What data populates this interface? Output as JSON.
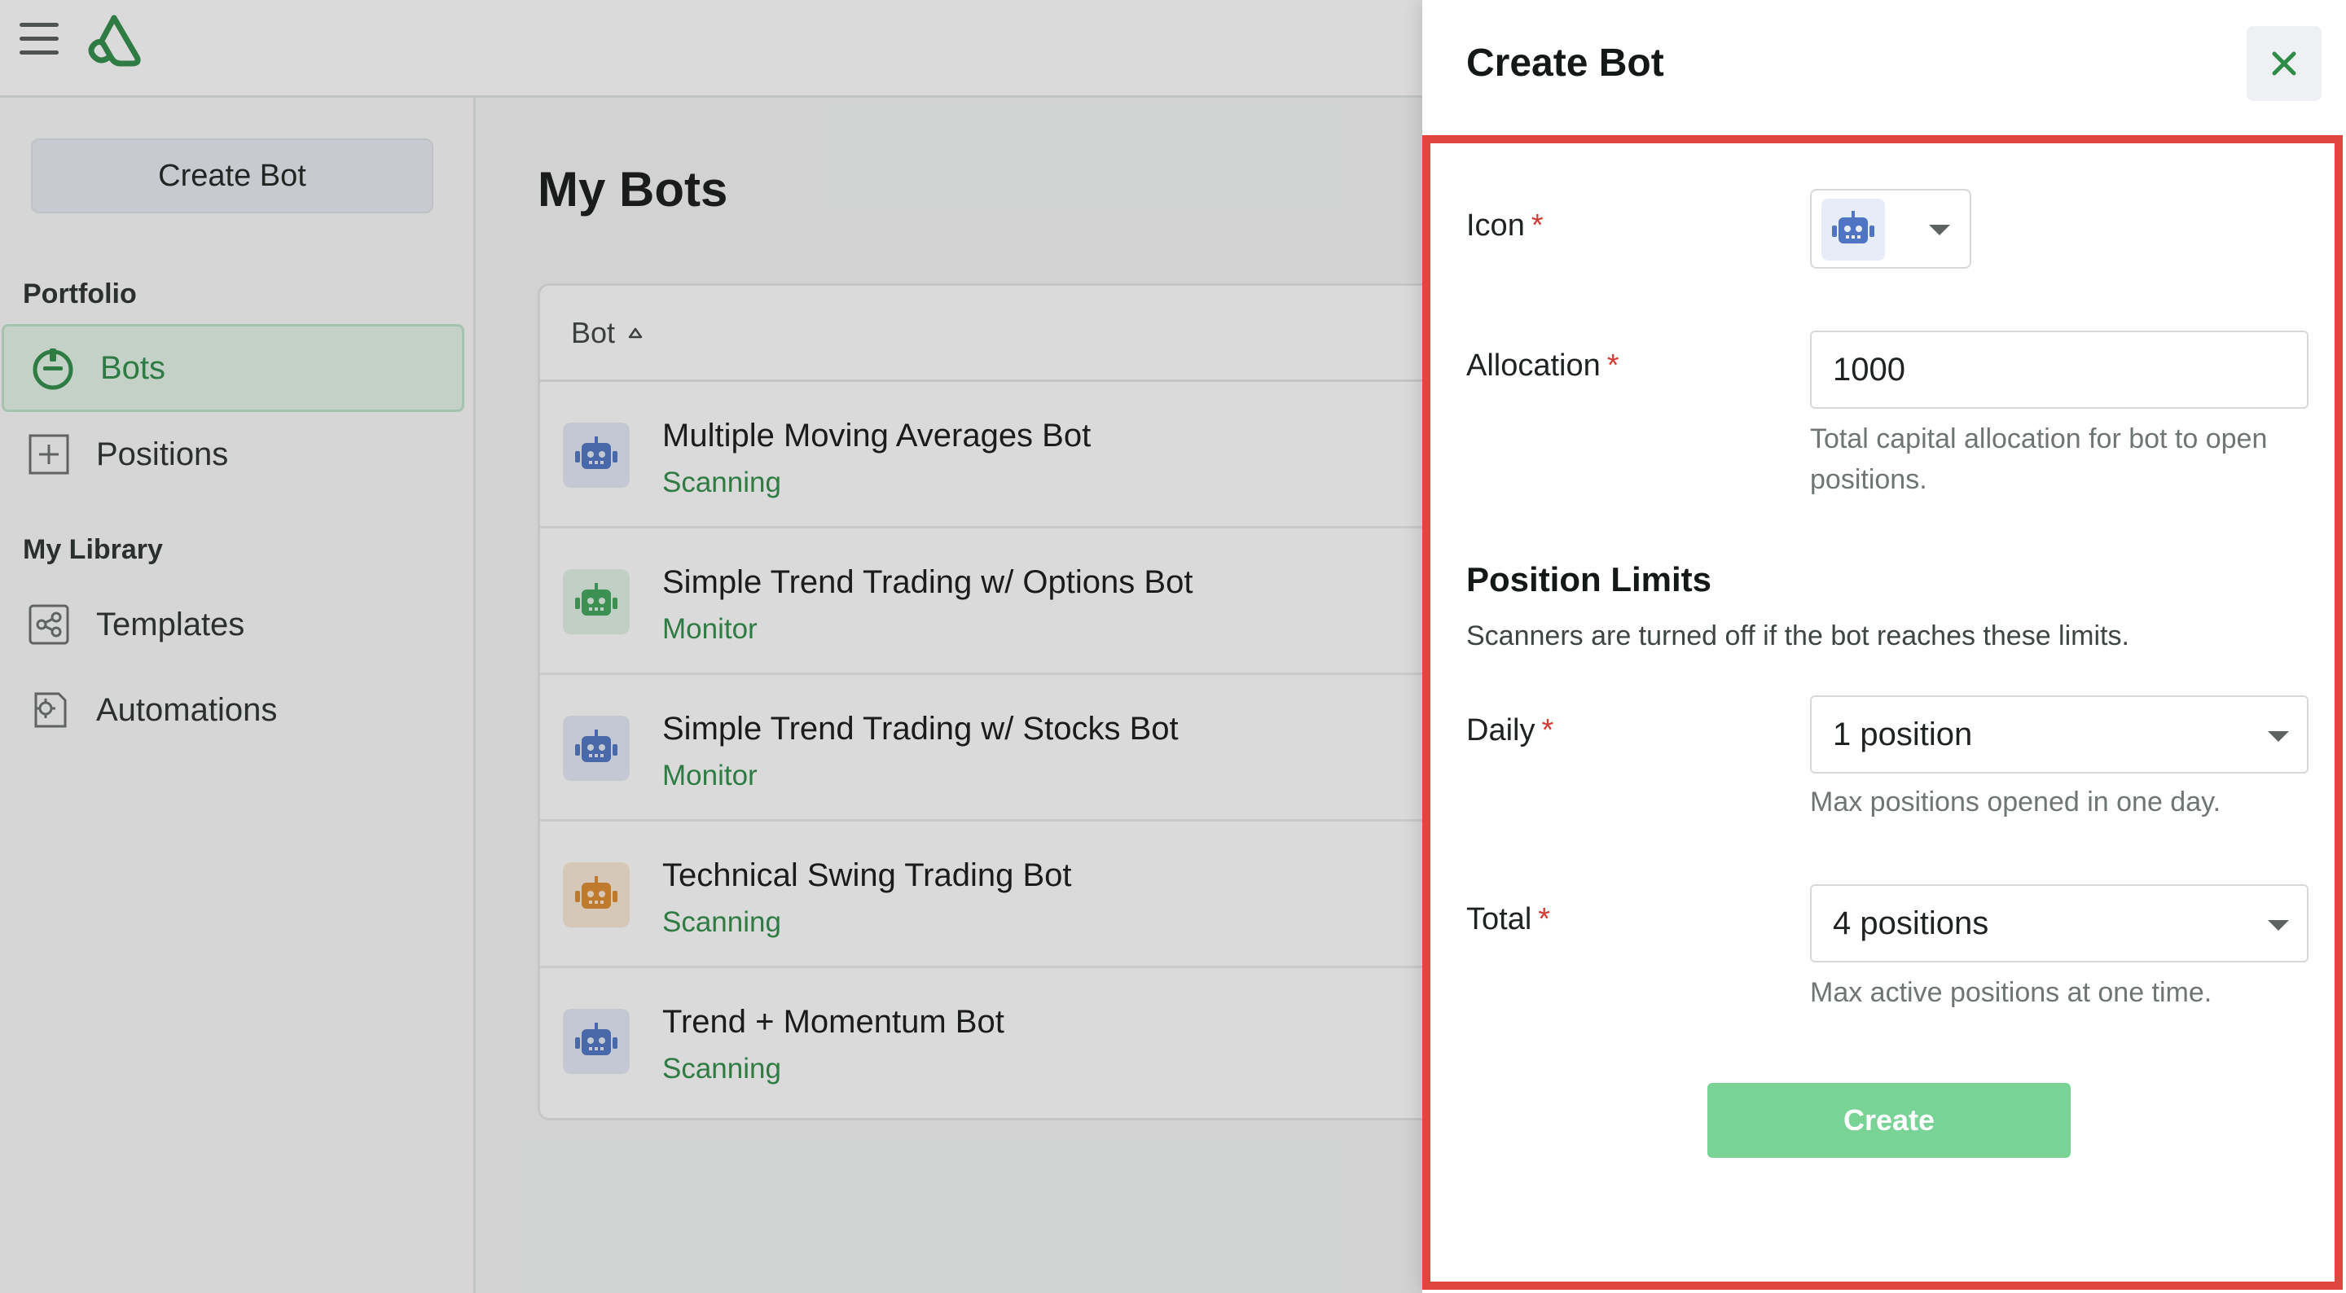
{
  "sidebar": {
    "create_button": "Create Bot",
    "portfolio_heading": "Portfolio",
    "library_heading": "My Library",
    "items": [
      {
        "label": "Bots"
      },
      {
        "label": "Positions"
      },
      {
        "label": "Templates"
      },
      {
        "label": "Automations"
      }
    ]
  },
  "main": {
    "title": "My Bots",
    "table": {
      "column_header": "Bot",
      "rows": [
        {
          "name": "Multiple Moving Averages Bot",
          "status": "Scanning",
          "icon_color": "blue"
        },
        {
          "name": "Simple Trend Trading w/ Options Bot",
          "status": "Monitor",
          "icon_color": "green"
        },
        {
          "name": "Simple Trend Trading w/ Stocks Bot",
          "status": "Monitor",
          "icon_color": "blue"
        },
        {
          "name": "Technical Swing Trading Bot",
          "status": "Scanning",
          "icon_color": "orange"
        },
        {
          "name": "Trend + Momentum Bot",
          "status": "Scanning",
          "icon_color": "blue"
        }
      ]
    }
  },
  "drawer": {
    "title": "Create Bot",
    "icon_label": "Icon",
    "allocation_label": "Allocation",
    "allocation_value": "1000",
    "allocation_help": "Total capital allocation for bot to open positions.",
    "limits_title": "Position Limits",
    "limits_desc": "Scanners are turned off if the bot reaches these limits.",
    "daily_label": "Daily",
    "daily_value": "1 position",
    "daily_help": "Max positions opened in one day.",
    "total_label": "Total",
    "total_value": "4 positions",
    "total_help": "Max active positions at one time.",
    "create_button": "Create",
    "required_mark": "*"
  },
  "colors": {
    "accent_green": "#2e8b47",
    "button_green": "#79d296",
    "highlight_red": "#e0463e",
    "icon_blue": "#4f74c4",
    "icon_green": "#3fa65a",
    "icon_orange": "#e08a2c"
  },
  "icons": [
    "menu-icon",
    "app-logo-icon",
    "bots-power-icon",
    "plus-square-icon",
    "share-icon",
    "automation-gear-icon",
    "robot-icon",
    "sort-asc-icon",
    "close-icon",
    "chevron-down-icon"
  ]
}
